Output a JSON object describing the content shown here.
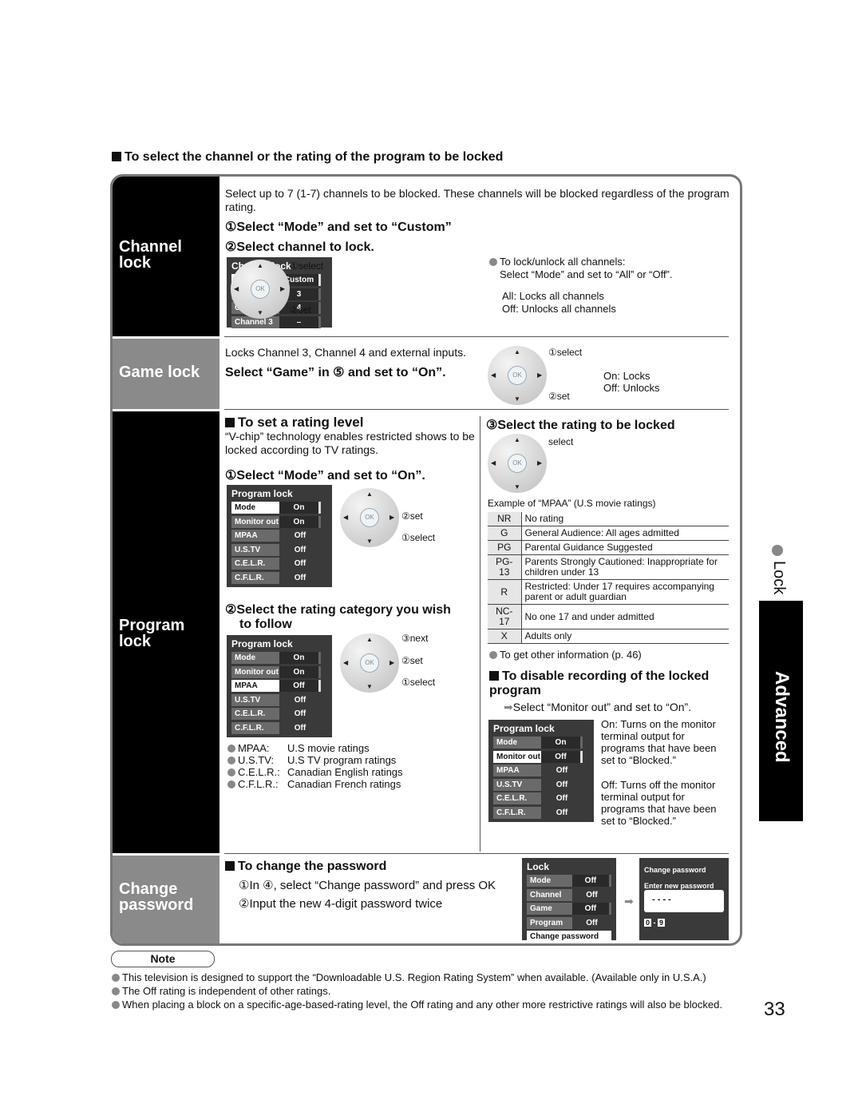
{
  "section_heading": "To select the channel or the rating of the program to be locked",
  "labels": {
    "channel": "Channel lock",
    "channel_l1": "Channel",
    "channel_l2": "lock",
    "game": "Game lock",
    "program_l1": "Program",
    "program_l2": "lock",
    "password_l1": "Change",
    "password_l2": "password"
  },
  "channel_lock": {
    "intro": "Select up to 7 (1-7) channels to be blocked. These channels will be blocked regardless of the program rating.",
    "step1": "①Select “Mode” and set to “Custom”",
    "step2": "②Select channel to lock.",
    "menu": {
      "title": "Channel lock",
      "rows": [
        {
          "k": "Mode",
          "v": "Custom"
        },
        {
          "k": "Channel 1",
          "v": "3"
        },
        {
          "k": "Channel 2",
          "v": "4"
        },
        {
          "k": "Channel 3",
          "v": "–"
        }
      ]
    },
    "pad": {
      "select": "①select",
      "set": "②set",
      "ok": "OK"
    },
    "tip": "To lock/unlock all channels:",
    "tip2": "Select “Mode” and set to “All” or “Off”.",
    "all": "All:  Locks all channels",
    "off": "Off:  Unlocks all channels"
  },
  "game_lock": {
    "intro": "Locks Channel 3, Channel 4 and external inputs.",
    "step": "Select “Game” in ⑤ and set to “On”.",
    "pad": {
      "select": "①select",
      "set": "②set",
      "ok": "OK"
    },
    "on": "On:  Locks",
    "off": "Off:  Unlocks"
  },
  "program_lock": {
    "heading": "To set a rating level",
    "intro": "“V-chip” technology enables restricted shows to be locked according to TV ratings.",
    "step1": "①Select “Mode” and set to “On”.",
    "menu1": {
      "title": "Program lock",
      "rows": [
        {
          "k": "Mode",
          "v": "On"
        },
        {
          "k": "Monitor out",
          "v": "On"
        },
        {
          "k": "MPAA",
          "v": "Off"
        },
        {
          "k": "U.S.TV",
          "v": "Off"
        },
        {
          "k": "C.E.L.R.",
          "v": "Off"
        },
        {
          "k": "C.F.L.R.",
          "v": "Off"
        }
      ]
    },
    "pad1": {
      "set": "②set",
      "select": "①select",
      "ok": "OK"
    },
    "step2a": "②Select the rating category you wish",
    "step2b": "to follow",
    "menu2": {
      "title": "Program lock",
      "rows": [
        {
          "k": "Mode",
          "v": "On"
        },
        {
          "k": "Monitor out",
          "v": "On"
        },
        {
          "k": "MPAA",
          "v": "Off"
        },
        {
          "k": "U.S.TV",
          "v": "Off"
        },
        {
          "k": "C.E.L.R.",
          "v": "Off"
        },
        {
          "k": "C.F.L.R.",
          "v": "Off"
        }
      ]
    },
    "pad2": {
      "next": "③next",
      "set": "②set",
      "select": "①select",
      "ok": "OK"
    },
    "legend": [
      {
        "k": "MPAA:",
        "v": "U.S movie ratings"
      },
      {
        "k": "U.S.TV:",
        "v": "U.S TV program ratings"
      },
      {
        "k": "C.E.L.R.:",
        "v": "Canadian English ratings"
      },
      {
        "k": "C.F.L.R.:",
        "v": "Canadian French ratings"
      }
    ],
    "step3": "③Select the rating to be locked",
    "pad3": {
      "select": "select",
      "ok": "OK"
    },
    "example": "Example of “MPAA” (U.S movie ratings)",
    "ratings": [
      {
        "c": "NR",
        "d": "No rating"
      },
      {
        "c": "G",
        "d": "General Audience:  All ages admitted"
      },
      {
        "c": "PG",
        "d": "Parental Guidance Suggested"
      },
      {
        "c": "PG-13",
        "d": "Parents Strongly Cautioned:  Inappropriate for children under 13"
      },
      {
        "c": "R",
        "d": "Restricted:  Under 17 requires accompanying parent or adult guardian"
      },
      {
        "c": "NC-17",
        "d": "No one 17 and under admitted"
      },
      {
        "c": "X",
        "d": "Adults only"
      }
    ],
    "other_info": "To get other information (p. 46)",
    "disable_heading": "To disable recording of the locked program",
    "disable_step": "Select “Monitor out” and set to “On”.",
    "menu3": {
      "title": "Program lock",
      "rows": [
        {
          "k": "Mode",
          "v": "On"
        },
        {
          "k": "Monitor out",
          "v": "Off"
        },
        {
          "k": "MPAA",
          "v": "Off"
        },
        {
          "k": "U.S.TV",
          "v": "Off"
        },
        {
          "k": "C.E.L.R.",
          "v": "Off"
        },
        {
          "k": "C.F.L.R.",
          "v": "Off"
        }
      ]
    },
    "on_desc": "On:  Turns on the monitor terminal output for programs that have been set to “Blocked.”",
    "off_desc": "Off:  Turns off the monitor terminal output for programs that have been set to “Blocked.”"
  },
  "change_password": {
    "heading": "To change the password",
    "step1": "①In ④, select “Change password” and press OK",
    "step2": "②Input the new 4-digit password twice",
    "menu": {
      "title": "Lock",
      "rows": [
        {
          "k": "Mode",
          "v": "Off"
        },
        {
          "k": "Channel",
          "v": "Off"
        },
        {
          "k": "Game",
          "v": "Off"
        },
        {
          "k": "Program",
          "v": "Off"
        }
      ],
      "last": "Change password"
    },
    "dialog": {
      "title": "Change password",
      "prompt": "Enter new password",
      "value": "- - - -",
      "key0": "0",
      "sep": "-",
      "key9": "9"
    }
  },
  "note": {
    "label": "Note",
    "items": [
      "This television is designed to support the  “Downloadable U.S. Region Rating System” when available.  (Available only in U.S.A.)",
      "The Off rating is independent of other ratings.",
      "When placing a block on a specific-age-based-rating level, the Off rating and any other more restrictive ratings will also be blocked."
    ]
  },
  "side": {
    "lock": "Lock",
    "advanced": "Advanced"
  },
  "page_number": "33"
}
